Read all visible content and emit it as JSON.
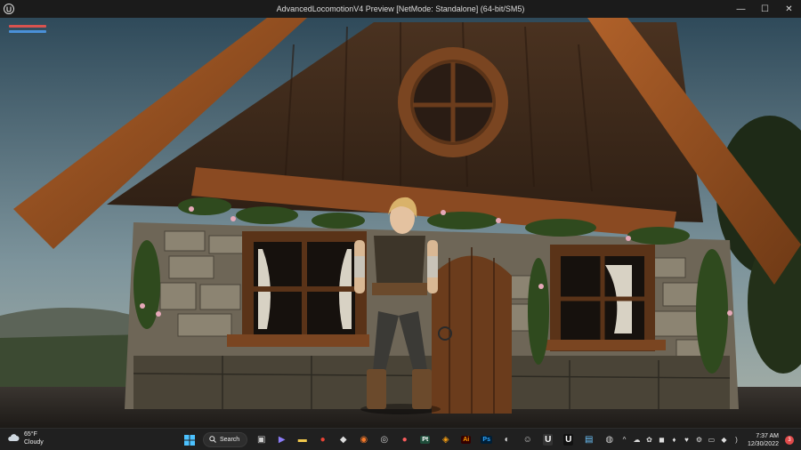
{
  "window": {
    "title": "AdvancedLocomotionV4 Preview [NetMode: Standalone]  (64-bit/SM5)",
    "minimize": "—",
    "maximize": "☐",
    "close": "✕"
  },
  "hud": {
    "health_color": "#d9534f",
    "stamina_color": "#4a90d9"
  },
  "taskbar": {
    "weather_temp": "65°F",
    "weather_desc": "Cloudy",
    "search_label": "Search",
    "apps": [
      {
        "name": "task-view",
        "glyph": "▣",
        "color": "#cfcfcf",
        "bg": "transparent"
      },
      {
        "name": "teams",
        "glyph": "▶",
        "color": "#8b7cf6",
        "bg": "transparent"
      },
      {
        "name": "file-explorer",
        "glyph": "▬",
        "color": "#f2c94c",
        "bg": "transparent"
      },
      {
        "name": "chrome",
        "glyph": "●",
        "color": "#ea4335",
        "bg": "transparent"
      },
      {
        "name": "unity",
        "glyph": "◆",
        "color": "#dddddd",
        "bg": "transparent"
      },
      {
        "name": "blender",
        "glyph": "◉",
        "color": "#f5792a",
        "bg": "transparent"
      },
      {
        "name": "obs",
        "glyph": "◎",
        "color": "#cccccc",
        "bg": "transparent"
      },
      {
        "name": "itch",
        "glyph": "●",
        "color": "#fa5c5c",
        "bg": "transparent"
      },
      {
        "name": "substance-painter",
        "glyph": "Pt",
        "color": "#ffffff",
        "bg": "#1e4d3a"
      },
      {
        "name": "marmoset",
        "glyph": "◈",
        "color": "#f39c12",
        "bg": "transparent"
      },
      {
        "name": "illustrator",
        "glyph": "Ai",
        "color": "#ff9a00",
        "bg": "#330000"
      },
      {
        "name": "photoshop",
        "glyph": "Ps",
        "color": "#31a8ff",
        "bg": "#001e36"
      },
      {
        "name": "davinci",
        "glyph": "◐",
        "color": "#dddddd",
        "bg": "transparent"
      },
      {
        "name": "discord",
        "glyph": "☺",
        "color": "#cccccc",
        "bg": "transparent"
      },
      {
        "name": "epic-games",
        "glyph": "U",
        "color": "#ffffff",
        "bg": "#333333"
      },
      {
        "name": "unreal-engine",
        "glyph": "U",
        "color": "#ffffff",
        "bg": "#111111"
      },
      {
        "name": "notepad",
        "glyph": "▤",
        "color": "#6ec6ff",
        "bg": "transparent"
      },
      {
        "name": "steam",
        "glyph": "◍",
        "color": "#cccccc",
        "bg": "transparent"
      }
    ],
    "tray": [
      "^",
      "☁",
      "✿",
      "◼",
      "♦",
      "♥",
      "⚙",
      "▭",
      "◆",
      ")"
    ],
    "time": "7:37 AM",
    "date": "12/30/2022",
    "notifications": "3"
  }
}
